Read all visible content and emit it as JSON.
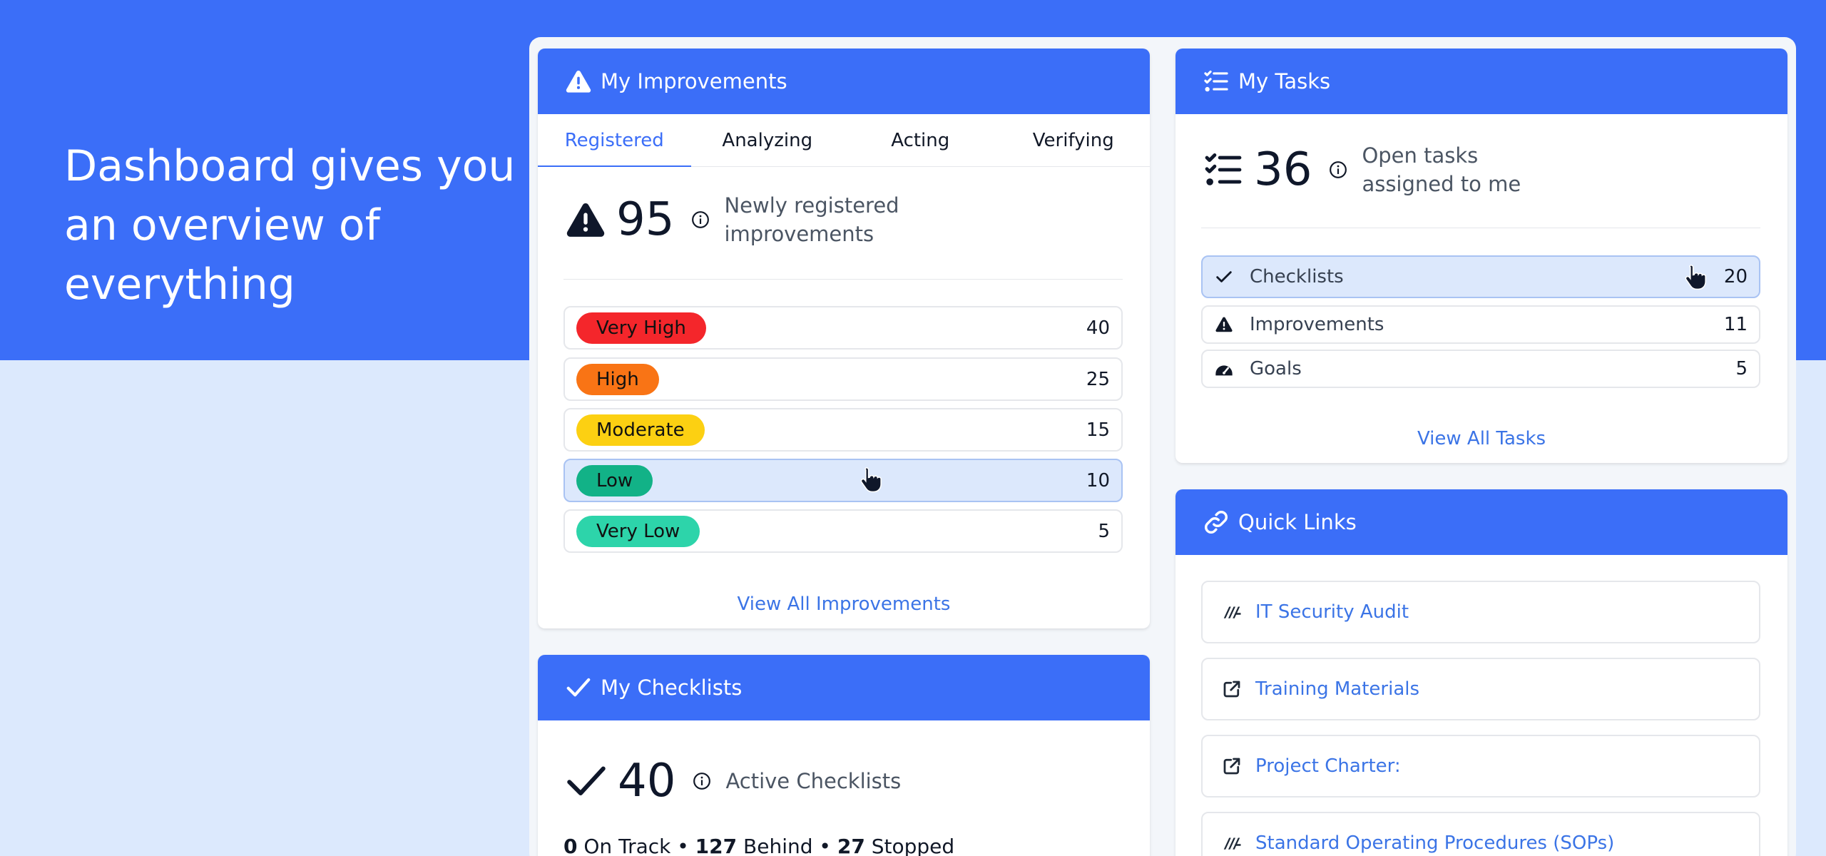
{
  "hero": {
    "headline": "Dashboard gives you an overview of everything"
  },
  "colors": {
    "brand_blue": "#3b6ef8",
    "background_light": "#dce9fd",
    "link_blue": "#3b74e6",
    "very_high": "#f4262b",
    "high": "#f97415",
    "moderate": "#fcd012",
    "low": "#12b287",
    "very_low": "#2dd4aa"
  },
  "improvements": {
    "title": "My Improvements",
    "tabs": [
      {
        "label": "Registered",
        "active": true
      },
      {
        "label": "Analyzing",
        "active": false
      },
      {
        "label": "Acting",
        "active": false
      },
      {
        "label": "Verifying",
        "active": false
      }
    ],
    "count": "95",
    "count_label": "Newly registered improvements",
    "priorities": [
      {
        "label": "Very High",
        "count": "40"
      },
      {
        "label": "High",
        "count": "25"
      },
      {
        "label": "Moderate",
        "count": "15"
      },
      {
        "label": "Low",
        "count": "10"
      },
      {
        "label": "Very Low",
        "count": "5"
      }
    ],
    "view_all": "View All Improvements"
  },
  "checklists": {
    "title": "My Checklists",
    "count": "40",
    "count_label": "Active Checklists",
    "on_track_count": "0",
    "on_track_label": "On Track",
    "behind_count": "127",
    "behind_label": "Behind",
    "stopped_count": "27",
    "stopped_label": "Stopped"
  },
  "tasks": {
    "title": "My Tasks",
    "count": "36",
    "count_label": "Open tasks assigned to me",
    "items": [
      {
        "label": "Checklists",
        "count": "20",
        "icon": "check-icon"
      },
      {
        "label": "Improvements",
        "count": "11",
        "icon": "warning-icon"
      },
      {
        "label": "Goals",
        "count": "5",
        "icon": "gauge-icon"
      }
    ],
    "view_all": "View All Tasks"
  },
  "quick_links": {
    "title": "Quick Links",
    "items": [
      {
        "label": "IT Security Audit",
        "icon": "app-logo-icon"
      },
      {
        "label": "Training Materials",
        "icon": "external-link-icon"
      },
      {
        "label": "Project Charter:",
        "icon": "external-link-icon"
      },
      {
        "label": "Standard Operating Procedures (SOPs)",
        "icon": "app-logo-icon"
      }
    ]
  }
}
